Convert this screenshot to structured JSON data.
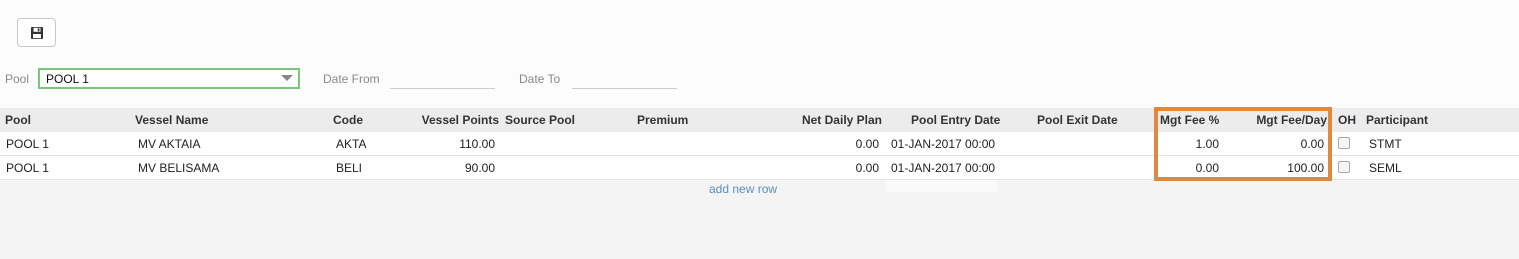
{
  "toolbar": {
    "save_icon": "floppy-disk-icon"
  },
  "filters": {
    "pool_label": "Pool",
    "pool_value": "POOL 1",
    "date_from_label": "Date From",
    "date_from_value": "",
    "date_to_label": "Date To",
    "date_to_value": ""
  },
  "grid": {
    "columns": {
      "pool": "Pool",
      "vessel_name": "Vessel Name",
      "code": "Code",
      "vessel_points": "Vessel Points",
      "source_pool": "Source Pool",
      "premium": "Premium",
      "net_daily_plan": "Net Daily Plan",
      "pool_entry_date": "Pool Entry Date",
      "pool_exit_date": "Pool Exit Date",
      "mgt_fee_pct": "Mgt Fee %",
      "mgt_fee_day": "Mgt Fee/Day",
      "oh": "OH",
      "participant": "Participant"
    },
    "rows": [
      {
        "pool": "POOL 1",
        "vessel_name": "MV AKTAIA",
        "code": "AKTA",
        "vessel_points": "110.00",
        "source_pool": "",
        "premium": "",
        "net_daily_plan": "0.00",
        "pool_entry_date": "01-JAN-2017 00:00",
        "pool_exit_date": "",
        "mgt_fee_pct": "1.00",
        "mgt_fee_day": "0.00",
        "oh": false,
        "participant": "STMT"
      },
      {
        "pool": "POOL 1",
        "vessel_name": "MV BELISAMA",
        "code": "BELI",
        "vessel_points": "90.00",
        "source_pool": "",
        "premium": "",
        "net_daily_plan": "0.00",
        "pool_entry_date": "01-JAN-2017 00:00",
        "pool_exit_date": "",
        "mgt_fee_pct": "0.00",
        "mgt_fee_day": "100.00",
        "oh": false,
        "participant": "SEML"
      }
    ],
    "add_row_label": "add new row"
  },
  "colors": {
    "highlight": "#e0883b",
    "pool_select_border": "#79c77c",
    "link": "#5a8ec0"
  }
}
